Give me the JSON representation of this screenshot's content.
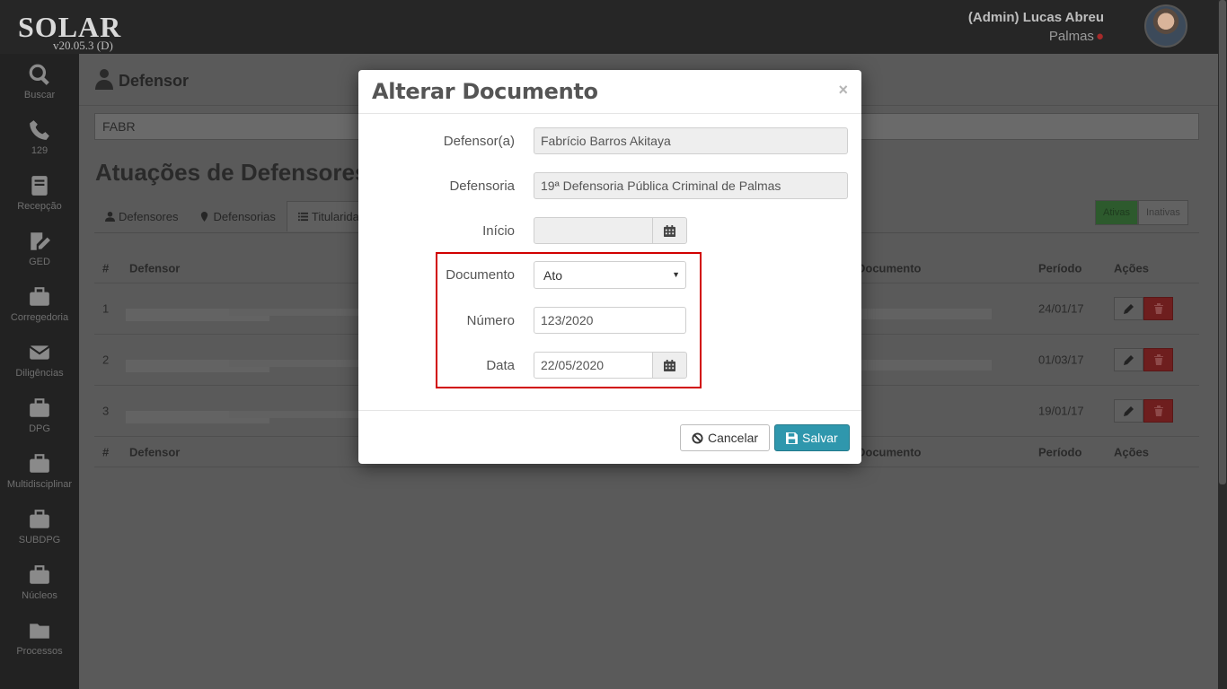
{
  "app": {
    "brand": "SOLAR",
    "version": "v20.05.3 (D)",
    "user_name": "(Admin) Lucas Abreu",
    "user_city": "Palmas"
  },
  "sidebar": {
    "items": [
      {
        "label": "Buscar",
        "icon": "search-icon"
      },
      {
        "label": "129",
        "icon": "phone-icon"
      },
      {
        "label": "Recepção",
        "icon": "book-icon"
      },
      {
        "label": "GED",
        "icon": "edit-document-icon"
      },
      {
        "label": "Corregedoria",
        "icon": "briefcase-icon"
      },
      {
        "label": "Diligências",
        "icon": "envelope-icon"
      },
      {
        "label": "DPG",
        "icon": "briefcase-icon"
      },
      {
        "label": "Multidisciplinar",
        "icon": "briefcase-icon"
      },
      {
        "label": "SUBDPG",
        "icon": "briefcase-icon"
      },
      {
        "label": "Núcleos",
        "icon": "briefcase-icon"
      },
      {
        "label": "Processos",
        "icon": "folder-icon"
      }
    ]
  },
  "page": {
    "header_title": "Defensor",
    "search_value": "FABR",
    "section_title": "Atuações de Defensores",
    "tabs": [
      "Defensores",
      "Defensorias",
      "Titularidades"
    ],
    "toggles": [
      "Ativas",
      "Inativas"
    ],
    "table": {
      "headers": {
        "num": "#",
        "defensor": "Defensor",
        "documento": "Documento",
        "periodo": "Período",
        "acoes": "Ações"
      },
      "rows": [
        {
          "num": "1",
          "periodo": "24/01/17"
        },
        {
          "num": "2",
          "periodo": "01/03/17"
        },
        {
          "num": "3",
          "periodo": "19/01/17"
        }
      ]
    }
  },
  "modal": {
    "title": "Alterar Documento",
    "close": "×",
    "fields": {
      "defensor_label": "Defensor(a)",
      "defensor_value": "Fabrício Barros Akitaya",
      "defensoria_label": "Defensoria",
      "defensoria_value": "19ª Defensoria Pública Criminal de Palmas",
      "inicio_label": "Início",
      "inicio_value": "",
      "documento_label": "Documento",
      "documento_value": "Ato",
      "numero_label": "Número",
      "numero_value": "123/2020",
      "data_label": "Data",
      "data_value": "22/05/2020"
    },
    "buttons": {
      "cancel": "Cancelar",
      "save": "Salvar"
    },
    "highlight_color": "#d10000",
    "save_color": "#2f97ad"
  }
}
